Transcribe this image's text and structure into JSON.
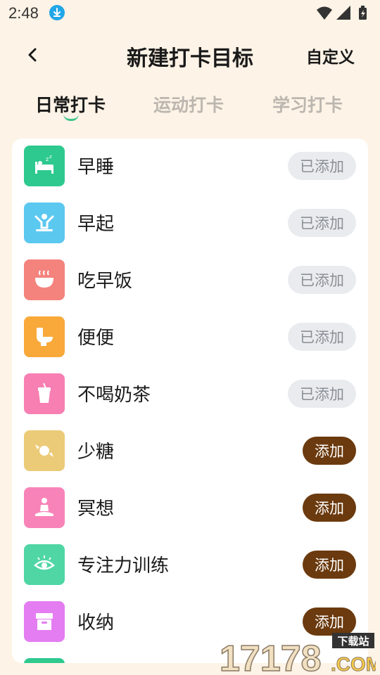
{
  "status": {
    "time": "2:48",
    "icons": [
      "download-icon",
      "wifi-icon",
      "signal-icon",
      "battery-icon"
    ]
  },
  "header": {
    "title": "新建打卡目标",
    "custom_label": "自定义"
  },
  "tabs": [
    {
      "label": "日常打卡",
      "active": true
    },
    {
      "label": "运动打卡",
      "active": false
    },
    {
      "label": "学习打卡",
      "active": false
    }
  ],
  "items": [
    {
      "label": "早睡",
      "icon": "sleep-bed-icon",
      "color": "#2ec98f",
      "button": "已添加",
      "added": true
    },
    {
      "label": "早起",
      "icon": "wake-up-icon",
      "color": "#5bc8f0",
      "button": "已添加",
      "added": true
    },
    {
      "label": "吃早饭",
      "icon": "breakfast-bowl-icon",
      "color": "#f4837d",
      "button": "已添加",
      "added": true
    },
    {
      "label": "便便",
      "icon": "toilet-icon",
      "color": "#f8a93a",
      "button": "已添加",
      "added": true
    },
    {
      "label": "不喝奶茶",
      "icon": "milk-tea-icon",
      "color": "#f87fb2",
      "button": "已添加",
      "added": true
    },
    {
      "label": "少糖",
      "icon": "candy-icon",
      "color": "#eccb78",
      "button": "添加",
      "added": false
    },
    {
      "label": "冥想",
      "icon": "meditation-icon",
      "color": "#f883b9",
      "button": "添加",
      "added": false
    },
    {
      "label": "专注力训练",
      "icon": "focus-eye-icon",
      "color": "#4fd6a4",
      "button": "添加",
      "added": false
    },
    {
      "label": "收纳",
      "icon": "storage-box-icon",
      "color": "#e47df2",
      "button": "添加",
      "added": false
    }
  ],
  "watermark": {
    "number": "17178",
    "sub": "下载站",
    "suffix": ".COM"
  }
}
